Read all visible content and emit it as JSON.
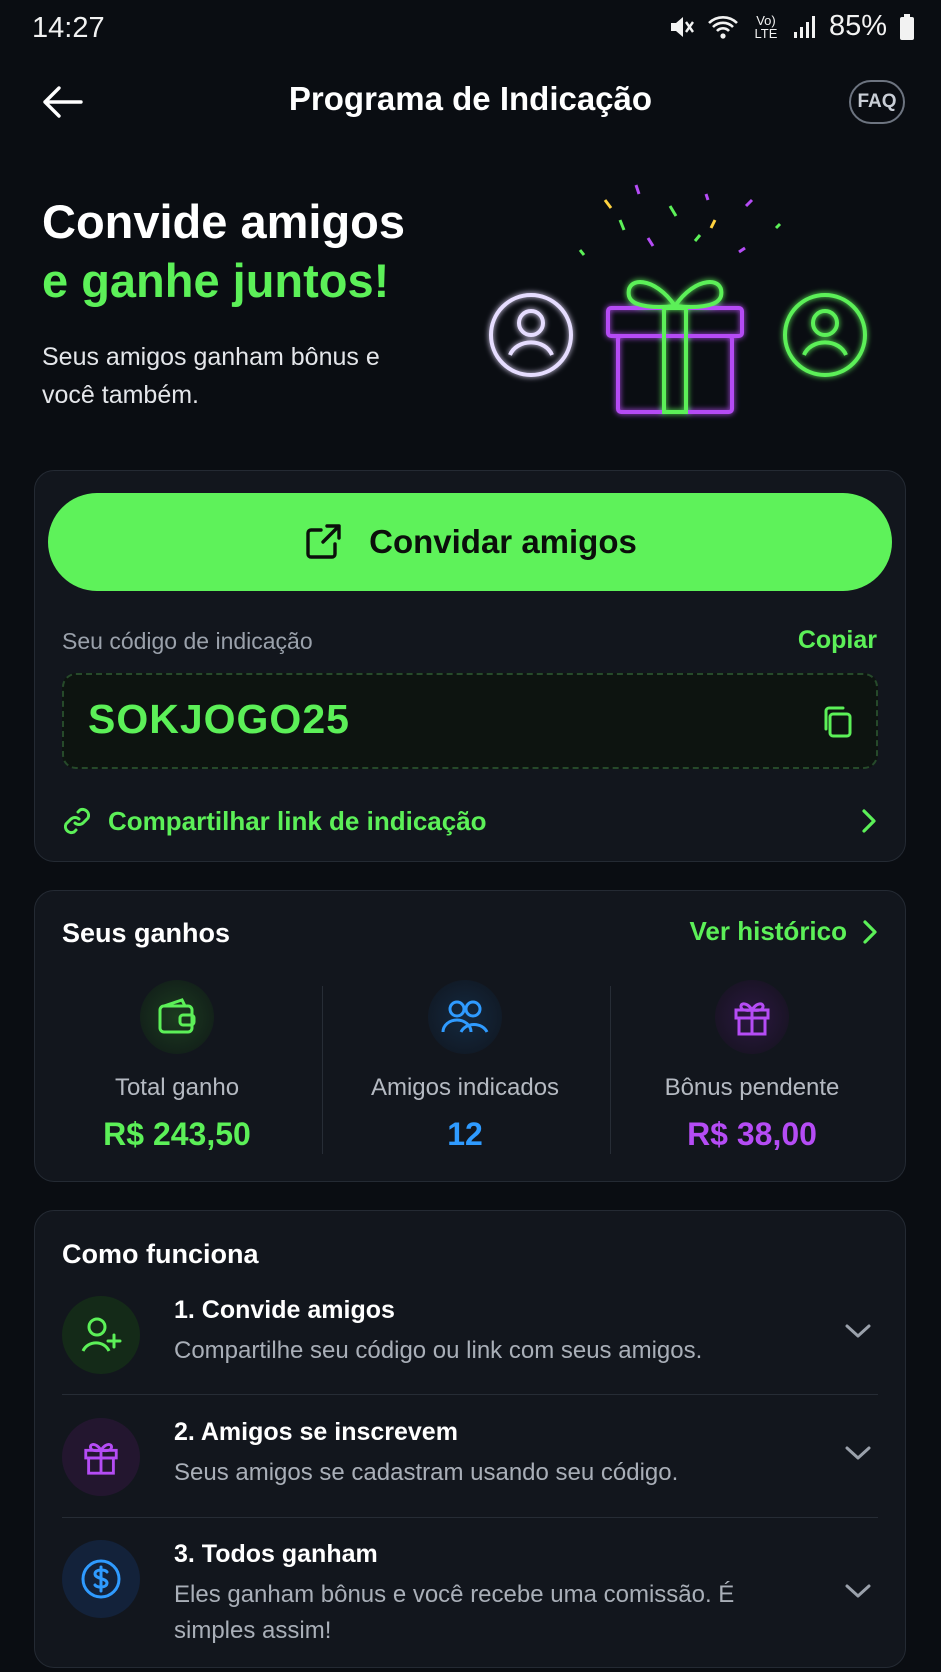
{
  "status_bar": {
    "time": "14:27",
    "network": "Vo) LTE",
    "battery": "85%"
  },
  "header": {
    "title": "Programa de Indicação",
    "faq_label": "FAQ"
  },
  "hero": {
    "line1": "Convide amigos",
    "line2": "e ganhe juntos!",
    "subtitle": "Seus amigos ganham bônus e você também."
  },
  "invite": {
    "button_label": "Convidar amigos",
    "code_label": "Seu código de indicação",
    "copy_label": "Copiar",
    "code": "SOKJOGO25",
    "share_label": "Compartilhar link de indicação"
  },
  "earnings": {
    "title": "Seus ganhos",
    "history_label": "Ver histórico",
    "stats": [
      {
        "label": "Total ganho",
        "value": "R$ 243,50",
        "color": "#5cf058"
      },
      {
        "label": "Amigos indicados",
        "value": "12",
        "color": "#2f9bff"
      },
      {
        "label": "Bônus pendente",
        "value": "R$ 38,00",
        "color": "#b54cf5"
      }
    ]
  },
  "how_it_works": {
    "title": "Como funciona",
    "steps": [
      {
        "title": "1. Convide amigos",
        "desc": "Compartilhe seu código ou link com seus amigos.",
        "icon": "user-plus-icon"
      },
      {
        "title": "2. Amigos se inscrevem",
        "desc": "Seus amigos se cadastram usando seu código.",
        "icon": "gift-icon"
      },
      {
        "title": "3. Todos ganham",
        "desc": "Eles ganham bônus e você recebe uma comissão. É simples assim!",
        "icon": "dollar-icon"
      }
    ]
  },
  "colors": {
    "accent": "#5cf058",
    "blue": "#2f9bff",
    "purple": "#b54cf5",
    "background": "#0a0d12"
  }
}
